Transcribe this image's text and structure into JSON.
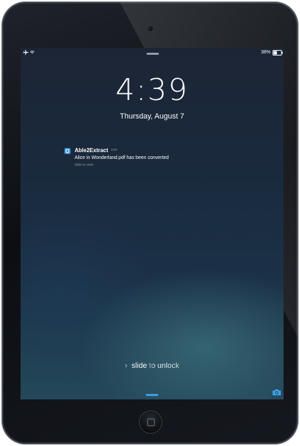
{
  "status_bar": {
    "battery_percent": "38%",
    "airplane_icon": "airplane-icon",
    "wifi_icon": "wifi-icon",
    "battery_icon": "battery-icon"
  },
  "lock_screen": {
    "time": "4:39",
    "date": "Thursday, August 7"
  },
  "notification": {
    "app_icon": "document-app-icon",
    "app_name": "Able2Extract",
    "time": "now",
    "message": "Alice in Wonderland.pdf has been converted",
    "hint": "slide to view"
  },
  "unlock": {
    "chevron": "›",
    "label": "slide to unlock"
  },
  "camera_icon": "camera-icon",
  "colors": {
    "accent_blue": "#3ea0e6"
  }
}
